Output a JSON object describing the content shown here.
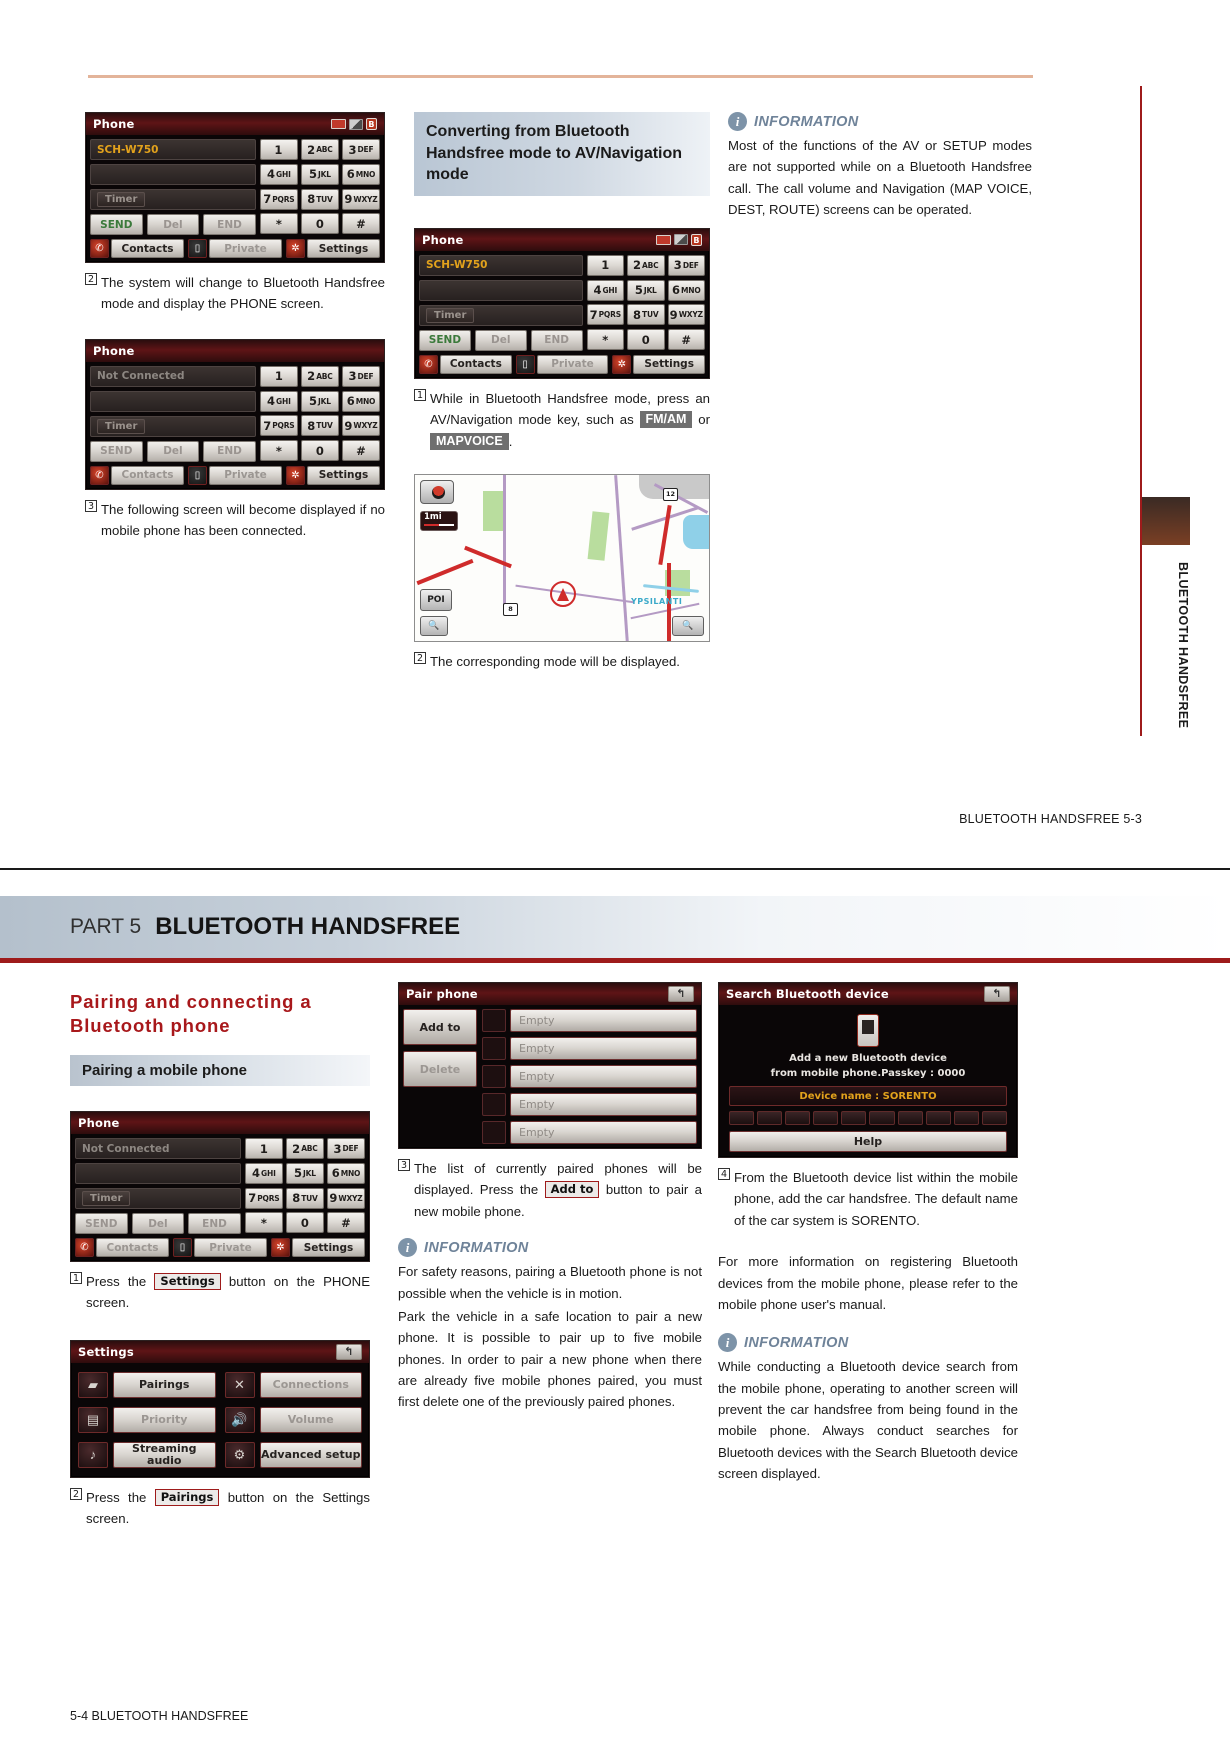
{
  "top_page": {
    "side_tab": "BLUETOOTH HANDSFREE",
    "footer": "BLUETOOTH HANDSFREE   5-3",
    "col1": {
      "phone_screen": {
        "title": "Phone",
        "device_name": "SCH-W750",
        "field_empty": "",
        "timer_label": "Timer",
        "send": "SEND",
        "del": "Del",
        "end": "END",
        "keys": [
          "1",
          "2",
          "3",
          "4",
          "5",
          "6",
          "7",
          "8",
          "9",
          "*",
          "0",
          "#"
        ],
        "key_subs": [
          "",
          "ABC",
          "DEF",
          "GHI",
          "JKL",
          "MNO",
          "PQRS",
          "TUV",
          "WXYZ",
          "",
          "",
          ""
        ],
        "contacts": "Contacts",
        "private": "Private",
        "settings": "Settings"
      },
      "step2_num": "2",
      "step2_text": "The system will change to Bluetooth Handsfree mode and display the PHONE screen.",
      "phone_screen2": {
        "title": "Phone",
        "device_name": "Not Connected"
      },
      "step3_num": "3",
      "step3_text": "The following screen will become displayed if no mobile phone has been connected."
    },
    "col2": {
      "section_heading": "Converting from Bluetooth Handsfree mode to AV/Navigation mode",
      "phone_screen": {
        "title": "Phone",
        "device_name": "SCH-W750"
      },
      "step1_num": "1",
      "step1_a": "While in Bluetooth Handsfree mode, press an AV/Navigation mode key, such as",
      "step1_key1": "FM/AM",
      "step1_or": "or",
      "step1_key2": "MAPVOICE",
      "step1_end": ".",
      "map": {
        "scale": "1mi",
        "poi": "POI",
        "shield_top": "12",
        "shield_left": "8",
        "town": "YPSILANTI"
      },
      "step2_num": "2",
      "step2_text": "The corresponding mode will be displayed."
    },
    "col3": {
      "info_title": "INFORMATION",
      "info_icon": "info-icon",
      "info_text": "Most of the functions of the AV or SETUP modes are not supported while on a Bluetooth Handsfree call. The call volume and Navigation (MAP VOICE, DEST, ROUTE) screens can be operated."
    }
  },
  "bottom_page": {
    "part_label": "PART 5",
    "part_title": "BLUETOOTH HANDSFREE",
    "footer": "5-4  BLUETOOTH HANDSFREE",
    "col1": {
      "red_heading": "Pairing and connecting a Bluetooth phone",
      "sub_heading": "Pairing a mobile phone",
      "phone_screen": {
        "title": "Phone",
        "device_name": "Not Connected",
        "timer_label": "Timer",
        "send": "SEND",
        "del": "Del",
        "end": "END",
        "contacts": "Contacts",
        "private": "Private",
        "settings": "Settings"
      },
      "step1_num": "1",
      "step1_a": "Press the",
      "step1_key": "Settings",
      "step1_b": "button on the PHONE screen.",
      "settings_screen": {
        "title": "Settings",
        "back_icon": "back-arrow-icon",
        "buttons": [
          {
            "label": "Pairings",
            "icon": "pairing-icon",
            "dim": false
          },
          {
            "label": "Connections",
            "icon": "connections-icon",
            "dim": true
          },
          {
            "label": "Priority",
            "icon": "priority-icon",
            "dim": true
          },
          {
            "label": "Volume",
            "icon": "volume-icon",
            "dim": true
          },
          {
            "label": "Streaming audio",
            "icon": "streaming-audio-icon",
            "dim": false
          },
          {
            "label": "Advanced setup",
            "icon": "advanced-setup-icon",
            "dim": false
          }
        ]
      },
      "step2_num": "2",
      "step2_a": "Press the",
      "step2_key": "Pairings",
      "step2_b": "button on the Settings screen."
    },
    "col2": {
      "pair_screen": {
        "title": "Pair phone",
        "back_icon": "back-arrow-icon",
        "add_to": "Add to",
        "delete": "Delete",
        "slots": [
          "Empty",
          "Empty",
          "Empty",
          "Empty",
          "Empty"
        ]
      },
      "step3_num": "3",
      "step3_a": "The list of currently paired phones will be displayed.  Press the",
      "step3_key": "Add to",
      "step3_b": "button to pair a new mobile phone.",
      "info_title": "INFORMATION",
      "info_text_1": "For safety reasons, pairing a Bluetooth phone is not possible when the vehicle is in motion.",
      "info_text_2": "Park the vehicle in a safe location to pair a new phone. It is possible to pair up to five mobile phones.  In order to pair a new phone when there are already five mobile phones paired, you must first delete one of the previously paired phones."
    },
    "col3": {
      "search_screen": {
        "title": "Search Bluetooth device",
        "back_icon": "back-arrow-icon",
        "line1": "Add a new Bluetooth device",
        "line2": "from mobile phone.Passkey : 0000",
        "device_name": "Device name : SORENTO",
        "help": "Help"
      },
      "step4_num": "4",
      "step4_text": "From the Bluetooth device list within the mobile phone, add the car handsfree. The default name of the car system is SORENTO.",
      "para": "For more information on registering Bluetooth devices from the mobile phone, please refer to the mobile phone user's manual.",
      "info_title": "INFORMATION",
      "info_text": "While conducting a Bluetooth device search from the mobile phone, operating to another screen will prevent the car handsfree from being found in the mobile phone. Always conduct searches for Bluetooth devices with the Search Bluetooth device screen displayed."
    }
  }
}
